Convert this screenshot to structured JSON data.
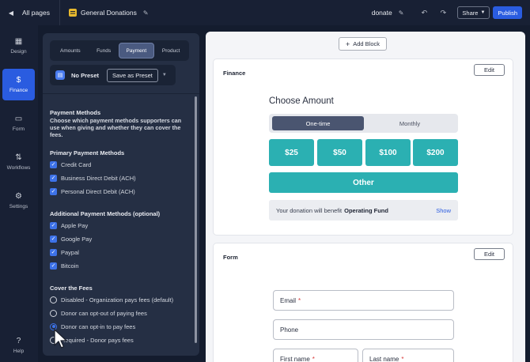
{
  "topbar": {
    "back_label": "All pages",
    "page_title": "General Donations",
    "slug": "donate",
    "share_label": "Share",
    "publish_label": "Publish"
  },
  "rail": {
    "items": [
      {
        "label": "Design",
        "icon": "layout-icon"
      },
      {
        "label": "Finance",
        "icon": "dollar-icon",
        "active": true
      },
      {
        "label": "Form",
        "icon": "form-icon"
      },
      {
        "label": "Workflows",
        "icon": "workflow-icon"
      },
      {
        "label": "Settings",
        "icon": "gear-icon"
      }
    ],
    "help_label": "Help"
  },
  "panel": {
    "tabs": [
      "Amounts",
      "Funds",
      "Payment",
      "Product"
    ],
    "active_tab": "Payment",
    "preset_label": "No Preset",
    "save_preset_label": "Save as Preset",
    "section_title": "Payment Methods",
    "section_desc": "Choose which payment methods supporters can use when giving and whether they can cover the fees.",
    "primary_title": "Primary Payment Methods",
    "primary_methods": [
      "Credit Card",
      "Business Direct Debit (ACH)",
      "Personal Direct Debit (ACH)"
    ],
    "additional_title": "Additional Payment Methods (optional)",
    "additional_methods": [
      "Apple Pay",
      "Google Pay",
      "Paypal",
      "Bitcoin"
    ],
    "fees_title": "Cover the Fees",
    "fee_options": [
      "Disabled - Organization pays fees (default)",
      "Donor can opt-out of paying fees",
      "Donor can opt-in to pay fees",
      "Required - Donor pays fees"
    ],
    "selected_fee_option": "Donor can opt-in to pay fees"
  },
  "canvas": {
    "add_block_label": "Add Block",
    "finance_card": {
      "title": "Finance",
      "edit_label": "Edit",
      "choose_title": "Choose Amount",
      "frequency": [
        "One-time",
        "Monthly"
      ],
      "selected_frequency": "One-time",
      "amounts": [
        "$25",
        "$50",
        "$100",
        "$200"
      ],
      "other_label": "Other",
      "benefit_prefix": "Your donation will benefit",
      "benefit_fund": "Operating Fund",
      "show_label": "Show"
    },
    "form_card": {
      "title": "Form",
      "edit_label": "Edit",
      "fields": {
        "email": "Email",
        "phone": "Phone",
        "first_name": "First name",
        "last_name": "Last name"
      },
      "required_mark": "*"
    }
  },
  "colors": {
    "accent": "#2a5ce0",
    "amount_button": "#2bb0b2",
    "panel_bg": "#252f44",
    "app_bg": "#182034"
  }
}
